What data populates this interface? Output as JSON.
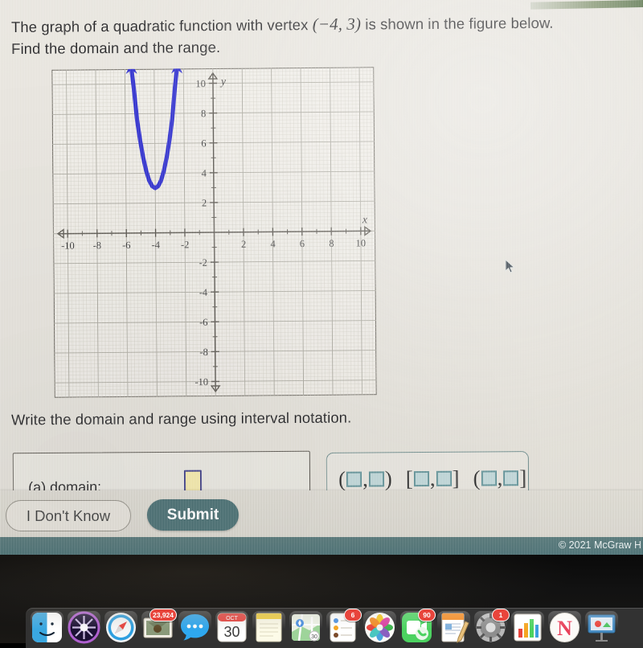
{
  "question": {
    "line1_pre": "The graph of a quadratic function with vertex ",
    "vertex": "(−4, 3)",
    "line1_post": " is shown in the figure below.",
    "line2": "Find the domain and the range."
  },
  "instruction": "Write the domain and range using interval notation.",
  "answer_panel": {
    "label": "(a)  domain:",
    "input_value": ""
  },
  "interval_palette": {
    "options": [
      "(□,□)",
      "[□,□]",
      "(□,□]"
    ],
    "open_open_left": "(",
    "open_open_right": ")",
    "closed_left": "[",
    "closed_right": "]",
    "half_left": "(",
    "half_right": "]",
    "comma": ","
  },
  "buttons": {
    "dont_know": "I Don't Know",
    "submit": "Submit"
  },
  "footer": {
    "copyright": "© 2021 McGraw H"
  },
  "colors": {
    "curve": "#2222cc",
    "submit_bg": "#41686c",
    "footer_bg": "#41686c",
    "input_fill": "#f5e9a8",
    "input_border": "#3b3b86",
    "palette_square": "#bcd4d6"
  },
  "chart_data": {
    "type": "line",
    "title": "",
    "xlabel": "x",
    "ylabel": "y",
    "xlim": [
      -11,
      11
    ],
    "ylim": [
      -11,
      11
    ],
    "grid": true,
    "x_ticks": [
      -10,
      -8,
      -6,
      -4,
      -2,
      2,
      4,
      6,
      8,
      10
    ],
    "y_ticks": [
      10,
      8,
      6,
      4,
      2,
      -2,
      -4,
      -6,
      -8,
      -10
    ],
    "x_tick_labels": [
      "-10",
      "-8",
      "-6",
      "-4",
      "-2",
      "2",
      "4",
      "6",
      "8",
      "10"
    ],
    "y_tick_labels": [
      "10",
      "8",
      "6",
      "4",
      "2",
      "-2",
      "-4",
      "-6",
      "-8",
      "-10"
    ],
    "minor_tick_step": 1,
    "series": [
      {
        "name": "quadratic",
        "vertex": [
          -4,
          3
        ],
        "opens": "up",
        "a": 3.2,
        "arrowheads": "both-ends-up",
        "x": [
          -5.55,
          -5.4,
          -5.2,
          -5.0,
          -4.8,
          -4.6,
          -4.4,
          -4.2,
          -4.0,
          -3.8,
          -3.6,
          -3.4,
          -3.2,
          -3.0,
          -2.8,
          -2.6,
          -2.45
        ],
        "y": [
          11.0,
          9.7,
          7.6,
          6.2,
          5.05,
          4.15,
          3.5,
          3.13,
          3.0,
          3.13,
          3.5,
          4.15,
          5.05,
          6.2,
          7.6,
          9.7,
          11.0
        ]
      }
    ]
  },
  "dock": {
    "items": [
      {
        "name": "finder",
        "badge": ""
      },
      {
        "name": "siri",
        "badge": ""
      },
      {
        "name": "safari",
        "badge": ""
      },
      {
        "name": "mail",
        "badge": "23,924"
      },
      {
        "name": "messages",
        "badge": ""
      },
      {
        "name": "calendar",
        "badge": "",
        "month": "OCT",
        "day": "30"
      },
      {
        "name": "notes",
        "badge": ""
      },
      {
        "name": "maps",
        "badge": ""
      },
      {
        "name": "reminders",
        "badge": "6"
      },
      {
        "name": "photos",
        "badge": ""
      },
      {
        "name": "facetime",
        "badge": "90"
      },
      {
        "name": "pages",
        "badge": ""
      },
      {
        "name": "system-preferences",
        "badge": "1"
      },
      {
        "name": "numbers",
        "badge": ""
      },
      {
        "name": "news",
        "badge": ""
      },
      {
        "name": "keynote",
        "badge": ""
      }
    ]
  }
}
